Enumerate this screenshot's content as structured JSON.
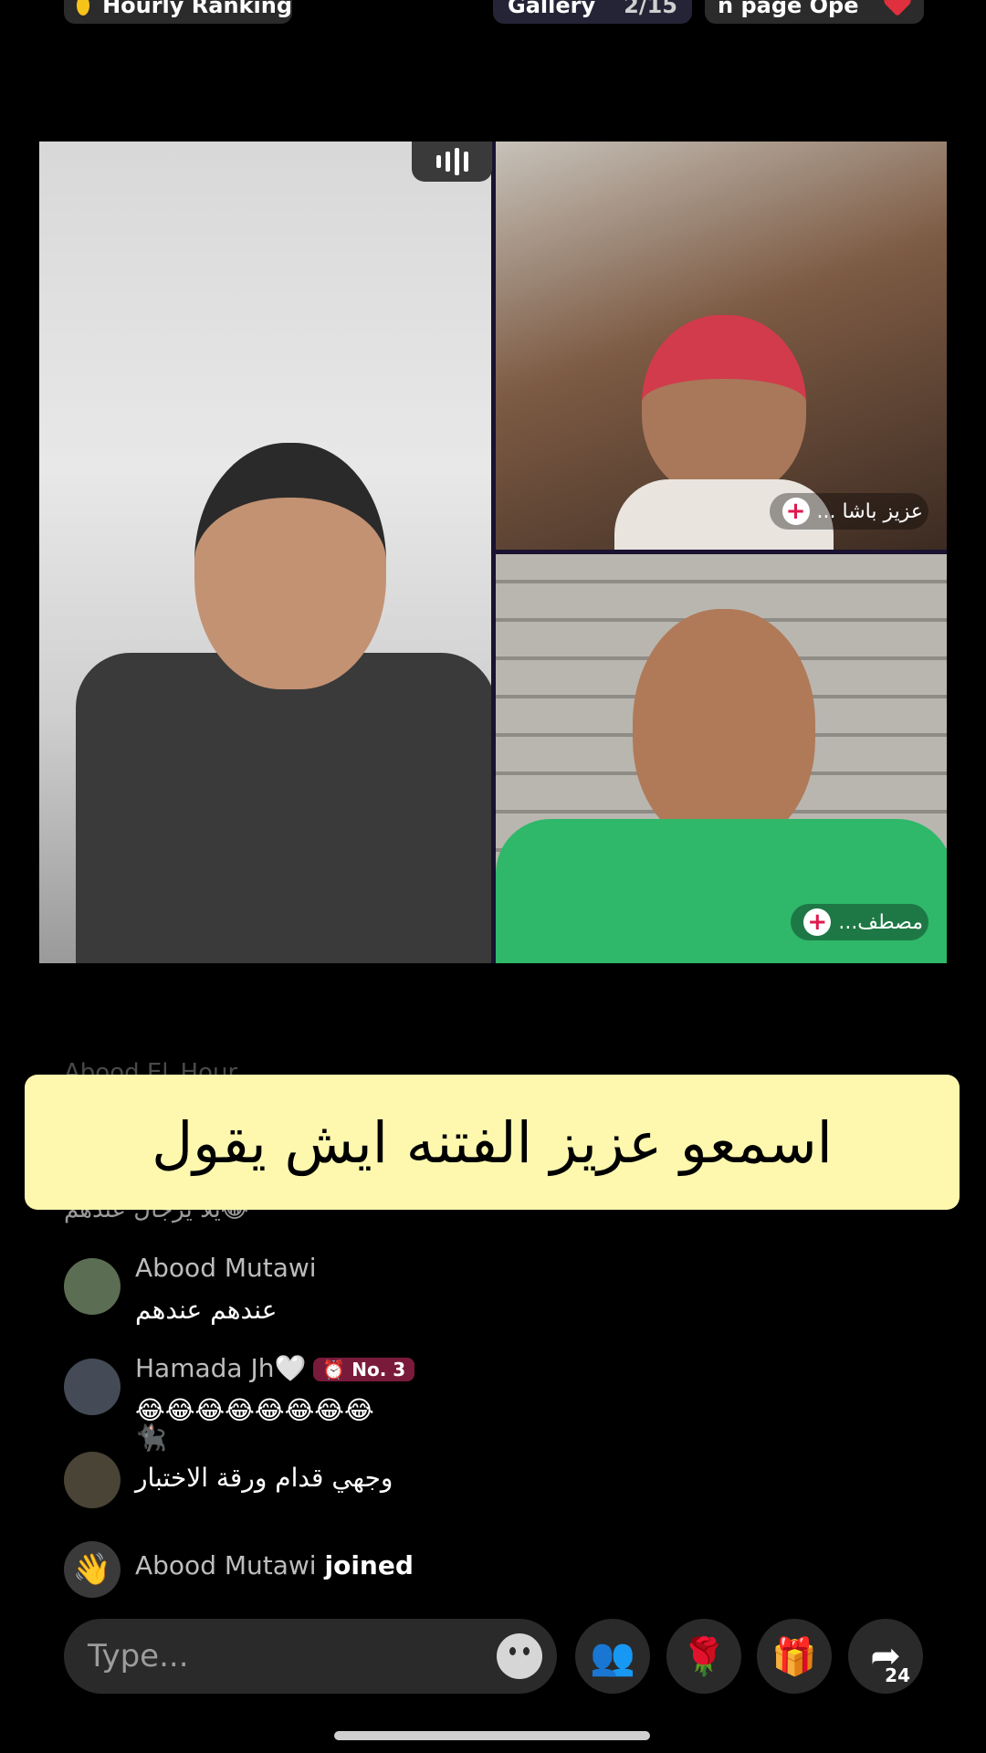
{
  "topbar": {
    "ranking_label": "Hourly Ranking",
    "gallery_label": "Gallery",
    "gallery_count": "2/15",
    "open_page_label": "n page   Ope"
  },
  "video": {
    "guest_top_name": "عزيز باشا ...",
    "guest_bottom_name": "مصطف..."
  },
  "caption": "اسمعو عزيز الفتنه ايش يقول",
  "faded_lines": {
    "name": "Abood El_Hour",
    "text": "يلا يرجال عندهم😂"
  },
  "chat": [
    {
      "user": "Abood Mutawi",
      "text": "عندهم عندهم",
      "badge": ""
    },
    {
      "user": "Hamada Jh🤍",
      "text": "😂😂😂😂😂😂😂😂",
      "badge": "⏰ No. 3"
    },
    {
      "user": "🐈‍⬛",
      "text": "وجهي قدام ورقة الاختبار",
      "badge": ""
    }
  ],
  "join_event": {
    "user": "Abood Mutawi",
    "action": "joined"
  },
  "input": {
    "placeholder": "Type..."
  },
  "share_count": "24",
  "colors": {
    "banner_bg": "#fdf8ae",
    "badge_bg": "#7a1a3a",
    "accent_pink": "#e0184e"
  }
}
